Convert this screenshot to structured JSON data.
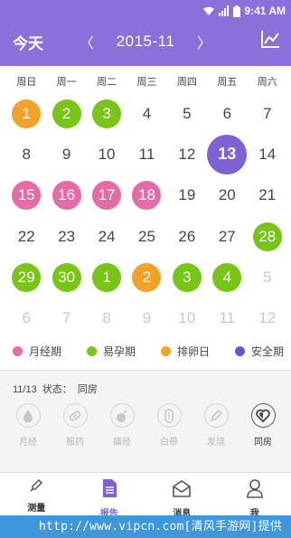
{
  "status_bar": {
    "time": "9:41 AM"
  },
  "header": {
    "today_label": "今天",
    "prev": "〈",
    "next": "〉",
    "month": "2015-11"
  },
  "weekdays": [
    "周日",
    "周一",
    "周二",
    "周三",
    "周四",
    "周五",
    "周六"
  ],
  "calendar": {
    "weeks": [
      [
        {
          "d": "1",
          "t": "orange"
        },
        {
          "d": "2",
          "t": "green"
        },
        {
          "d": "3",
          "t": "green"
        },
        {
          "d": "4",
          "t": ""
        },
        {
          "d": "5",
          "t": ""
        },
        {
          "d": "6",
          "t": ""
        },
        {
          "d": "7",
          "t": ""
        }
      ],
      [
        {
          "d": "8",
          "t": ""
        },
        {
          "d": "9",
          "t": ""
        },
        {
          "d": "10",
          "t": ""
        },
        {
          "d": "11",
          "t": ""
        },
        {
          "d": "12",
          "t": ""
        },
        {
          "d": "13",
          "t": "today"
        },
        {
          "d": "14",
          "t": ""
        }
      ],
      [
        {
          "d": "15",
          "t": "pink"
        },
        {
          "d": "16",
          "t": "pink"
        },
        {
          "d": "17",
          "t": "pink"
        },
        {
          "d": "18",
          "t": "pink"
        },
        {
          "d": "19",
          "t": ""
        },
        {
          "d": "20",
          "t": ""
        },
        {
          "d": "21",
          "t": ""
        }
      ],
      [
        {
          "d": "22",
          "t": ""
        },
        {
          "d": "23",
          "t": ""
        },
        {
          "d": "24",
          "t": ""
        },
        {
          "d": "25",
          "t": ""
        },
        {
          "d": "26",
          "t": ""
        },
        {
          "d": "27",
          "t": ""
        },
        {
          "d": "28",
          "t": "green"
        }
      ],
      [
        {
          "d": "29",
          "t": "green"
        },
        {
          "d": "30",
          "t": "green"
        },
        {
          "d": "1",
          "t": "green"
        },
        {
          "d": "2",
          "t": "orange"
        },
        {
          "d": "3",
          "t": "green"
        },
        {
          "d": "4",
          "t": "green"
        },
        {
          "d": "5",
          "t": "muted"
        }
      ],
      [
        {
          "d": "6",
          "t": "muted"
        },
        {
          "d": "7",
          "t": "muted"
        },
        {
          "d": "8",
          "t": "muted"
        },
        {
          "d": "9",
          "t": "muted"
        },
        {
          "d": "10",
          "t": "muted"
        },
        {
          "d": "11",
          "t": "muted"
        },
        {
          "d": "12",
          "t": "muted"
        }
      ]
    ]
  },
  "legend": [
    {
      "label": "月经期",
      "color": "#e66aa5"
    },
    {
      "label": "易孕期",
      "color": "#77c516"
    },
    {
      "label": "排卵日",
      "color": "#f0a22b"
    },
    {
      "label": "安全期",
      "color": "#5b5bc9"
    }
  ],
  "status_panel": {
    "date": "11/13",
    "status_label": "状态：",
    "status_value": "同房",
    "items": [
      {
        "label": "月经",
        "icon": "drop-icon",
        "active": false
      },
      {
        "label": "服药",
        "icon": "pill-icon",
        "active": false
      },
      {
        "label": "痛经",
        "icon": "bomb-icon",
        "active": false
      },
      {
        "label": "白带",
        "icon": "pad-icon",
        "active": false
      },
      {
        "label": "发烧",
        "icon": "thermometer-icon",
        "active": false
      },
      {
        "label": "同房",
        "icon": "heart-icon",
        "active": true
      }
    ]
  },
  "tabs": [
    {
      "label": "测量",
      "icon": "thermometer-icon",
      "active": false
    },
    {
      "label": "报告",
      "icon": "document-icon",
      "active": true
    },
    {
      "label": "消息",
      "icon": "envelope-icon",
      "active": false
    },
    {
      "label": "我",
      "icon": "person-icon",
      "active": false
    }
  ],
  "watermark": "http://www.vipcn.com[清风手游网]提供"
}
